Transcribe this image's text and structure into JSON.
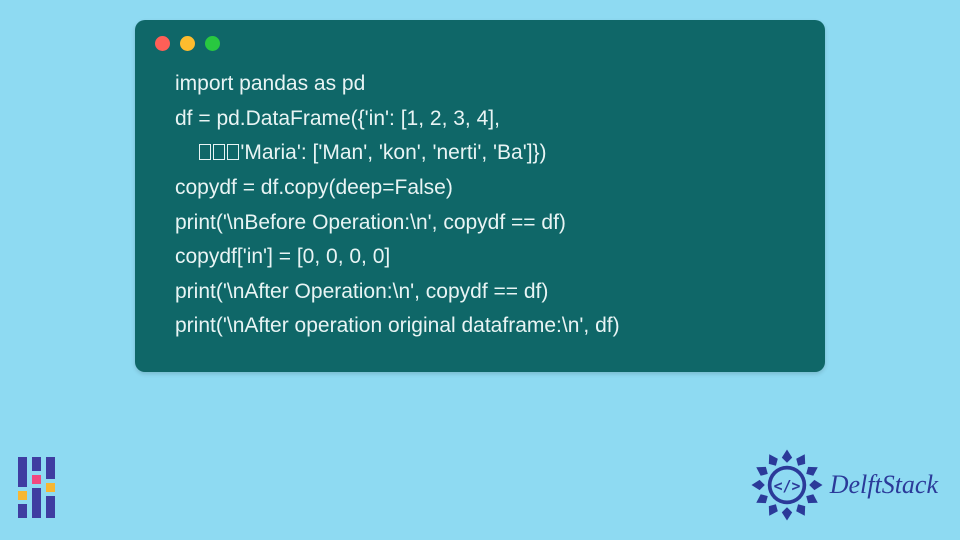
{
  "code": {
    "lines": [
      "import pandas as pd",
      "df = pd.DataFrame({'in': [1, 2, 3, 4],",
      {
        "indent": true,
        "tofu": 3,
        "text": "'Maria': ['Man', 'kon', 'nerti', 'Ba']})"
      },
      "copydf = df.copy(deep=False)",
      "print('\\nBefore Operation:\\n', copydf == df)",
      "copydf['in'] = [0, 0, 0, 0]",
      "print('\\nAfter Operation:\\n', copydf == df)",
      "print('\\nAfter operation original dataframe:\\n', df)"
    ]
  },
  "window_controls": {
    "red": "close",
    "yellow": "minimize",
    "green": "maximize"
  },
  "brand": {
    "name": "DelftStack"
  },
  "colors": {
    "page_bg": "#8edaf2",
    "card_bg": "#0f6768",
    "code_fg": "#e8f4f4",
    "brand_text": "#2b3a99"
  }
}
